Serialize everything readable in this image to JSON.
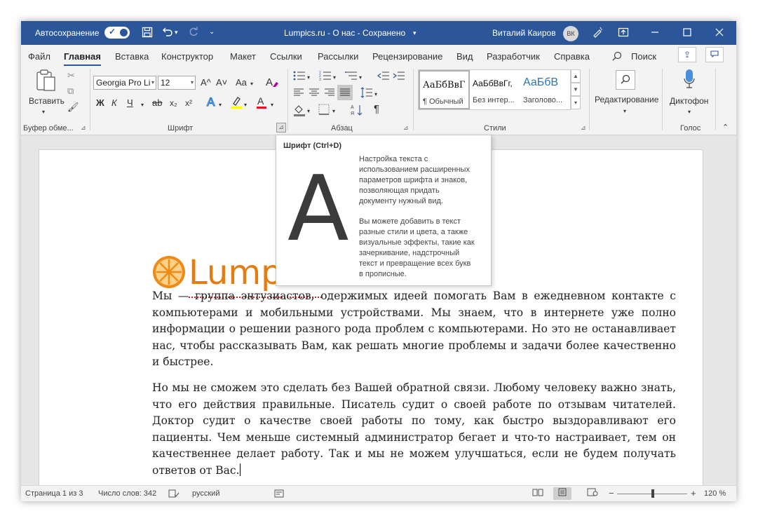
{
  "titlebar": {
    "autosave_label": "Автосохранение",
    "doc_title": "Lumpics.ru - О нас - Сохранено",
    "title_dropdown": "▾",
    "user_name": "Виталий Каиров",
    "user_initials": "ВК",
    "icons": [
      "save-icon",
      "undo-icon",
      "redo-icon",
      "customize-icon",
      "pen-icon",
      "ribbon-display-icon",
      "minimize-icon",
      "maximize-icon",
      "close-icon"
    ]
  },
  "tabs": [
    "Файл",
    "Главная",
    "Вставка",
    "Конструктор",
    "Макет",
    "Ссылки",
    "Рассылки",
    "Рецензирование",
    "Вид",
    "Разработчик",
    "Справка"
  ],
  "active_tab": "Главная",
  "search_label": "Поиск",
  "ribbon": {
    "clipboard": {
      "paste_label": "Вставить",
      "group_label": "Буфер обме..."
    },
    "font": {
      "font_name": "Georgia Pro Li",
      "font_size": "12",
      "grow": "A^",
      "shrink": "A˅",
      "case": "Aa",
      "bold": "Ж",
      "italic": "К",
      "underline": "Ч",
      "strike": "ab",
      "subscript": "x₂",
      "superscript": "x²",
      "group_label": "Шрифт"
    },
    "paragraph": {
      "group_label": "Абзац"
    },
    "styles": {
      "items": [
        {
          "sample": "АаБбВвГ",
          "name": "¶ Обычный"
        },
        {
          "sample": "АаБбВвГг,",
          "name": "Без интер..."
        },
        {
          "sample": "АаБбВ",
          "name": "Заголово..."
        }
      ],
      "group_label": "Стили"
    },
    "editing": {
      "label": "Редактирование"
    },
    "voice": {
      "label": "Диктофон",
      "group_label": "Голос"
    }
  },
  "tooltip": {
    "title": "Шрифт (Ctrl+D)",
    "big_letter": "A",
    "desc1": "Настройка текста с\nиспользованием расширенных\nпараметров шрифта и знаков,\nпозволяющая придать\nдокументу нужный вид.",
    "desc2": "Вы можете добавить в текст\nразные стили и цвета, а также\nвизуальные эффекты, такие как\nзачеркивание, надстрочный\nтекст и превращение всех букв\nв прописные."
  },
  "document": {
    "logo_text": "Lumpics",
    "paragraph1": "Мы — группа энтузиастов, одержимых идеей помогать Вам в ежедневном контакте с компьютерами и мобильными устройствами. Мы знаем, что в интернете уже полно информации о решении разного рода проблем с компьютерами. Но это не останавливает нас, чтобы рассказывать Вам, как решать многие проблемы и задачи более качественно и быстрее.",
    "paragraph2": "Но мы не сможем это сделать без Вашей обратной связи. Любому человеку важно знать, что его действия правильные. Писатель судит о своей работе по отзывам читателей. Доктор судит о качестве своей работы по тому, как быстро выздоравливают его пациенты. Чем меньше системный администратор бегает и что-то настраивает, тем он качественнее делает работу. Так и мы не можем улучшаться, если не будем получать ответов от Вас."
  },
  "statusbar": {
    "page": "Страница 1 из 3",
    "words": "Число слов: 342",
    "language": "русский",
    "zoom_minus": "−",
    "zoom_plus": "+",
    "zoom": "120 %"
  },
  "colors": {
    "accent": "#2b579a",
    "logo": "#e57c11",
    "highlight": "#ffff00",
    "font_color": "#e81123"
  }
}
